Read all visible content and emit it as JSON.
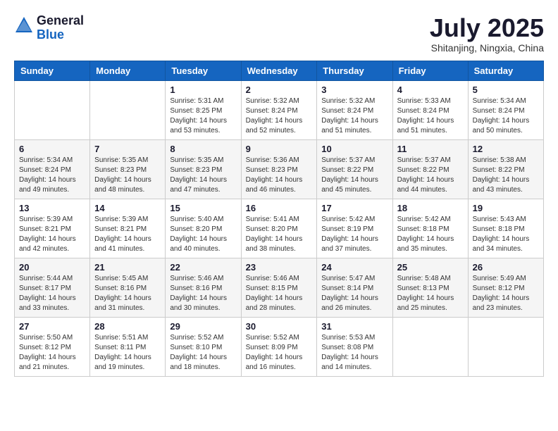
{
  "header": {
    "logo_general": "General",
    "logo_blue": "Blue",
    "month_title": "July 2025",
    "location": "Shitanjing, Ningxia, China"
  },
  "days_of_week": [
    "Sunday",
    "Monday",
    "Tuesday",
    "Wednesday",
    "Thursday",
    "Friday",
    "Saturday"
  ],
  "weeks": [
    [
      {
        "day": "",
        "sunrise": "",
        "sunset": "",
        "daylight": ""
      },
      {
        "day": "",
        "sunrise": "",
        "sunset": "",
        "daylight": ""
      },
      {
        "day": "1",
        "sunrise": "Sunrise: 5:31 AM",
        "sunset": "Sunset: 8:25 PM",
        "daylight": "Daylight: 14 hours and 53 minutes."
      },
      {
        "day": "2",
        "sunrise": "Sunrise: 5:32 AM",
        "sunset": "Sunset: 8:24 PM",
        "daylight": "Daylight: 14 hours and 52 minutes."
      },
      {
        "day": "3",
        "sunrise": "Sunrise: 5:32 AM",
        "sunset": "Sunset: 8:24 PM",
        "daylight": "Daylight: 14 hours and 51 minutes."
      },
      {
        "day": "4",
        "sunrise": "Sunrise: 5:33 AM",
        "sunset": "Sunset: 8:24 PM",
        "daylight": "Daylight: 14 hours and 51 minutes."
      },
      {
        "day": "5",
        "sunrise": "Sunrise: 5:34 AM",
        "sunset": "Sunset: 8:24 PM",
        "daylight": "Daylight: 14 hours and 50 minutes."
      }
    ],
    [
      {
        "day": "6",
        "sunrise": "Sunrise: 5:34 AM",
        "sunset": "Sunset: 8:24 PM",
        "daylight": "Daylight: 14 hours and 49 minutes."
      },
      {
        "day": "7",
        "sunrise": "Sunrise: 5:35 AM",
        "sunset": "Sunset: 8:23 PM",
        "daylight": "Daylight: 14 hours and 48 minutes."
      },
      {
        "day": "8",
        "sunrise": "Sunrise: 5:35 AM",
        "sunset": "Sunset: 8:23 PM",
        "daylight": "Daylight: 14 hours and 47 minutes."
      },
      {
        "day": "9",
        "sunrise": "Sunrise: 5:36 AM",
        "sunset": "Sunset: 8:23 PM",
        "daylight": "Daylight: 14 hours and 46 minutes."
      },
      {
        "day": "10",
        "sunrise": "Sunrise: 5:37 AM",
        "sunset": "Sunset: 8:22 PM",
        "daylight": "Daylight: 14 hours and 45 minutes."
      },
      {
        "day": "11",
        "sunrise": "Sunrise: 5:37 AM",
        "sunset": "Sunset: 8:22 PM",
        "daylight": "Daylight: 14 hours and 44 minutes."
      },
      {
        "day": "12",
        "sunrise": "Sunrise: 5:38 AM",
        "sunset": "Sunset: 8:22 PM",
        "daylight": "Daylight: 14 hours and 43 minutes."
      }
    ],
    [
      {
        "day": "13",
        "sunrise": "Sunrise: 5:39 AM",
        "sunset": "Sunset: 8:21 PM",
        "daylight": "Daylight: 14 hours and 42 minutes."
      },
      {
        "day": "14",
        "sunrise": "Sunrise: 5:39 AM",
        "sunset": "Sunset: 8:21 PM",
        "daylight": "Daylight: 14 hours and 41 minutes."
      },
      {
        "day": "15",
        "sunrise": "Sunrise: 5:40 AM",
        "sunset": "Sunset: 8:20 PM",
        "daylight": "Daylight: 14 hours and 40 minutes."
      },
      {
        "day": "16",
        "sunrise": "Sunrise: 5:41 AM",
        "sunset": "Sunset: 8:20 PM",
        "daylight": "Daylight: 14 hours and 38 minutes."
      },
      {
        "day": "17",
        "sunrise": "Sunrise: 5:42 AM",
        "sunset": "Sunset: 8:19 PM",
        "daylight": "Daylight: 14 hours and 37 minutes."
      },
      {
        "day": "18",
        "sunrise": "Sunrise: 5:42 AM",
        "sunset": "Sunset: 8:18 PM",
        "daylight": "Daylight: 14 hours and 35 minutes."
      },
      {
        "day": "19",
        "sunrise": "Sunrise: 5:43 AM",
        "sunset": "Sunset: 8:18 PM",
        "daylight": "Daylight: 14 hours and 34 minutes."
      }
    ],
    [
      {
        "day": "20",
        "sunrise": "Sunrise: 5:44 AM",
        "sunset": "Sunset: 8:17 PM",
        "daylight": "Daylight: 14 hours and 33 minutes."
      },
      {
        "day": "21",
        "sunrise": "Sunrise: 5:45 AM",
        "sunset": "Sunset: 8:16 PM",
        "daylight": "Daylight: 14 hours and 31 minutes."
      },
      {
        "day": "22",
        "sunrise": "Sunrise: 5:46 AM",
        "sunset": "Sunset: 8:16 PM",
        "daylight": "Daylight: 14 hours and 30 minutes."
      },
      {
        "day": "23",
        "sunrise": "Sunrise: 5:46 AM",
        "sunset": "Sunset: 8:15 PM",
        "daylight": "Daylight: 14 hours and 28 minutes."
      },
      {
        "day": "24",
        "sunrise": "Sunrise: 5:47 AM",
        "sunset": "Sunset: 8:14 PM",
        "daylight": "Daylight: 14 hours and 26 minutes."
      },
      {
        "day": "25",
        "sunrise": "Sunrise: 5:48 AM",
        "sunset": "Sunset: 8:13 PM",
        "daylight": "Daylight: 14 hours and 25 minutes."
      },
      {
        "day": "26",
        "sunrise": "Sunrise: 5:49 AM",
        "sunset": "Sunset: 8:12 PM",
        "daylight": "Daylight: 14 hours and 23 minutes."
      }
    ],
    [
      {
        "day": "27",
        "sunrise": "Sunrise: 5:50 AM",
        "sunset": "Sunset: 8:12 PM",
        "daylight": "Daylight: 14 hours and 21 minutes."
      },
      {
        "day": "28",
        "sunrise": "Sunrise: 5:51 AM",
        "sunset": "Sunset: 8:11 PM",
        "daylight": "Daylight: 14 hours and 19 minutes."
      },
      {
        "day": "29",
        "sunrise": "Sunrise: 5:52 AM",
        "sunset": "Sunset: 8:10 PM",
        "daylight": "Daylight: 14 hours and 18 minutes."
      },
      {
        "day": "30",
        "sunrise": "Sunrise: 5:52 AM",
        "sunset": "Sunset: 8:09 PM",
        "daylight": "Daylight: 14 hours and 16 minutes."
      },
      {
        "day": "31",
        "sunrise": "Sunrise: 5:53 AM",
        "sunset": "Sunset: 8:08 PM",
        "daylight": "Daylight: 14 hours and 14 minutes."
      },
      {
        "day": "",
        "sunrise": "",
        "sunset": "",
        "daylight": ""
      },
      {
        "day": "",
        "sunrise": "",
        "sunset": "",
        "daylight": ""
      }
    ]
  ]
}
